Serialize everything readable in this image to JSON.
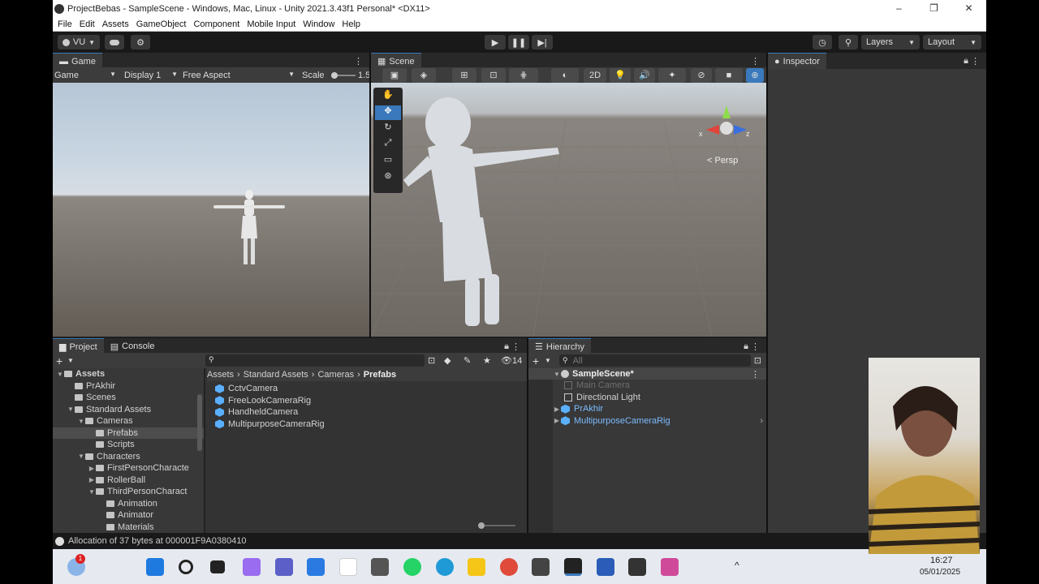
{
  "window": {
    "title": "ProjectBebas - SampleScene - Windows, Mac, Linux - Unity 2021.3.43f1 Personal* <DX11>",
    "minimize": "–",
    "maximize": "❐",
    "close": "✕"
  },
  "menu": [
    "File",
    "Edit",
    "Assets",
    "GameObject",
    "Component",
    "Mobile Input",
    "Window",
    "Help"
  ],
  "toolbar": {
    "account": "VU",
    "layers": "Layers",
    "layout": "Layout"
  },
  "game": {
    "tab": "Game",
    "mode": "Game",
    "display": "Display 1",
    "aspect": "Free Aspect",
    "scale_label": "Scale",
    "scale_value": "1.5"
  },
  "scene": {
    "tab": "Scene",
    "mode2d": "2D",
    "persp": "< Persp",
    "axis_x": "x",
    "axis_z": "z",
    "axis_y": "y"
  },
  "inspector": {
    "tab": "Inspector"
  },
  "project": {
    "tab": "Project",
    "console_tab": "Console",
    "hidden_count": "14",
    "tree": [
      {
        "label": "Assets",
        "depth": 0,
        "open": true,
        "bold": true
      },
      {
        "label": "PrAkhir",
        "depth": 1
      },
      {
        "label": "Scenes",
        "depth": 1
      },
      {
        "label": "Standard Assets",
        "depth": 1,
        "open": true
      },
      {
        "label": "Cameras",
        "depth": 2,
        "open": true
      },
      {
        "label": "Prefabs",
        "depth": 3,
        "selected": true
      },
      {
        "label": "Scripts",
        "depth": 3
      },
      {
        "label": "Characters",
        "depth": 2,
        "open": true
      },
      {
        "label": "FirstPersonCharacte",
        "depth": 3,
        "closed": true
      },
      {
        "label": "RollerBall",
        "depth": 3,
        "closed": true
      },
      {
        "label": "ThirdPersonCharact",
        "depth": 3,
        "open": true
      },
      {
        "label": "Animation",
        "depth": 4
      },
      {
        "label": "Animator",
        "depth": 4
      },
      {
        "label": "Materials",
        "depth": 4
      }
    ],
    "breadcrumb": [
      "Assets",
      "Standard Assets",
      "Cameras",
      "Prefabs"
    ],
    "files": [
      "CctvCamera",
      "FreeLookCameraRig",
      "HandheldCamera",
      "MultipurposeCameraRig"
    ]
  },
  "hierarchy": {
    "tab": "Hierarchy",
    "search_placeholder": "All",
    "scene": "SampleScene*",
    "items": [
      {
        "label": "Main Camera",
        "dim": true
      },
      {
        "label": "Directional Light"
      },
      {
        "label": "PrAkhir",
        "prefab": true
      },
      {
        "label": "MultipurposeCameraRig",
        "prefab": true
      }
    ]
  },
  "status": {
    "message": "Allocation of 37 bytes at 000001F9A0380410"
  },
  "taskbar": {
    "time": "16:27",
    "date": "05/01/2025",
    "badge": "1"
  },
  "colors": {
    "accent": "#3a79bb",
    "prefab": "#7cbcff",
    "panel": "#383838"
  }
}
